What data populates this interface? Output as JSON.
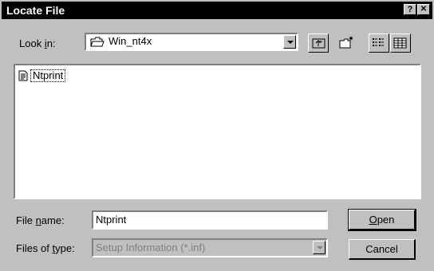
{
  "dialog": {
    "title": "Locate File",
    "help_label": "?",
    "close_label": "✕"
  },
  "look_in": {
    "label_prefix": "Look ",
    "label_accel": "i",
    "label_suffix": "n:",
    "value": "Win_nt4x"
  },
  "files": [
    {
      "name": "Ntprint",
      "icon": "setup-info-file-icon"
    }
  ],
  "file_name": {
    "label_prefix": "File ",
    "label_accel": "n",
    "label_suffix": "ame:",
    "value": "Ntprint"
  },
  "file_type": {
    "label_prefix": "Files of ",
    "label_accel": "t",
    "label_suffix": "ype:",
    "value": "Setup Information (*.inf)"
  },
  "buttons": {
    "open_accel": "O",
    "open_rest": "pen",
    "cancel": "Cancel"
  }
}
